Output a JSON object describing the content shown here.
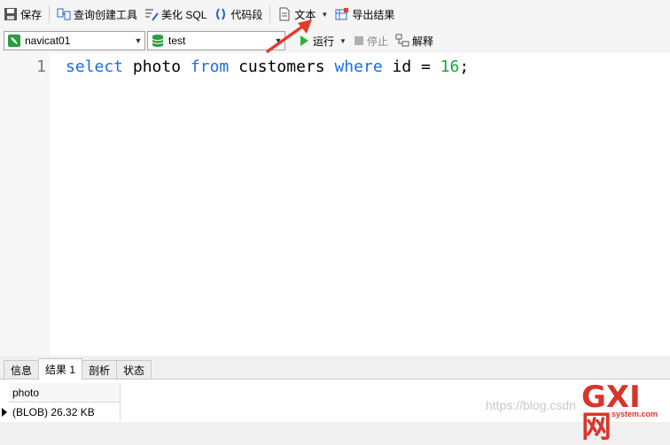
{
  "toolbar": {
    "save": "保存",
    "query_builder": "查询创建工具",
    "beautify_sql": "美化 SQL",
    "snippet": "代码段",
    "text": "文本",
    "export": "导出结果"
  },
  "connection": {
    "value": "navicat01"
  },
  "database": {
    "value": "test"
  },
  "run": {
    "run": "运行",
    "stop": "停止",
    "explain": "解释"
  },
  "editor": {
    "line_number": "1",
    "tokens": {
      "t1": "select",
      "t2": " photo ",
      "t3": "from",
      "t4": " customers ",
      "t5": "where",
      "t6": " id = ",
      "t7": "16",
      "t8": ";"
    }
  },
  "tabs": [
    "信息",
    "结果 1",
    "剖析",
    "状态"
  ],
  "result": {
    "column": "photo",
    "value": "(BLOB) 26.32 KB"
  },
  "watermark": "https://blog.csdn",
  "logo": {
    "big": "GXI网",
    "small": "system.com"
  },
  "colors": {
    "keyword": "#1b6de0",
    "number": "#1aa33b",
    "arrow": "#e53a2a",
    "logo": "#d9342b"
  }
}
